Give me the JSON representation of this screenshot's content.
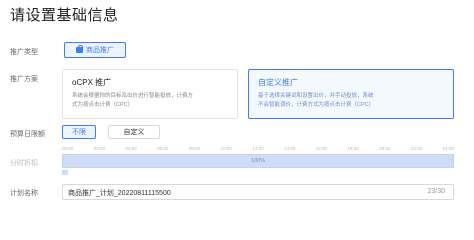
{
  "page": {
    "title": "请设置基础信息"
  },
  "promotion_type": {
    "label": "推广类型",
    "option": {
      "icon": "shopping-bag-icon",
      "label": "商品推广"
    }
  },
  "promotion_method": {
    "label": "推广方案",
    "options": [
      {
        "title": "oCPX 推广",
        "desc_line1": "系统会根据你的目标及出价进行智能投放，计费方",
        "desc_line2": "式为按点击计费（CPC）",
        "selected": false
      },
      {
        "title": "自定义推广",
        "desc_line1": "基于选择关键词和设置出价，并手动投放，系统",
        "desc_line2": "不会智能调价，计费方式为按点击计费（CPC）",
        "selected": true
      }
    ]
  },
  "daily_budget": {
    "label": "预算日限额",
    "options": [
      {
        "label": "不限",
        "selected": true
      },
      {
        "label": "自定义",
        "selected": false
      }
    ]
  },
  "time_discount": {
    "label": "分时折扣",
    "hours": [
      "00:00",
      "02:00",
      "04:00",
      "06:00",
      "08:00",
      "10:00",
      "12:00",
      "14:00",
      "16:00",
      "18:00",
      "20:00",
      "22:00",
      "24:00"
    ],
    "discount_value": "100%",
    "discount_fraction": 1.0,
    "legend_left": "",
    "legend_right": ""
  },
  "plan_name": {
    "label": "计划名称",
    "value": "商品推广_计划_20220811115500",
    "counter": "23/30"
  },
  "colors": {
    "accent": "#3f7ff5",
    "grid_fill": "#cfdcf7"
  }
}
